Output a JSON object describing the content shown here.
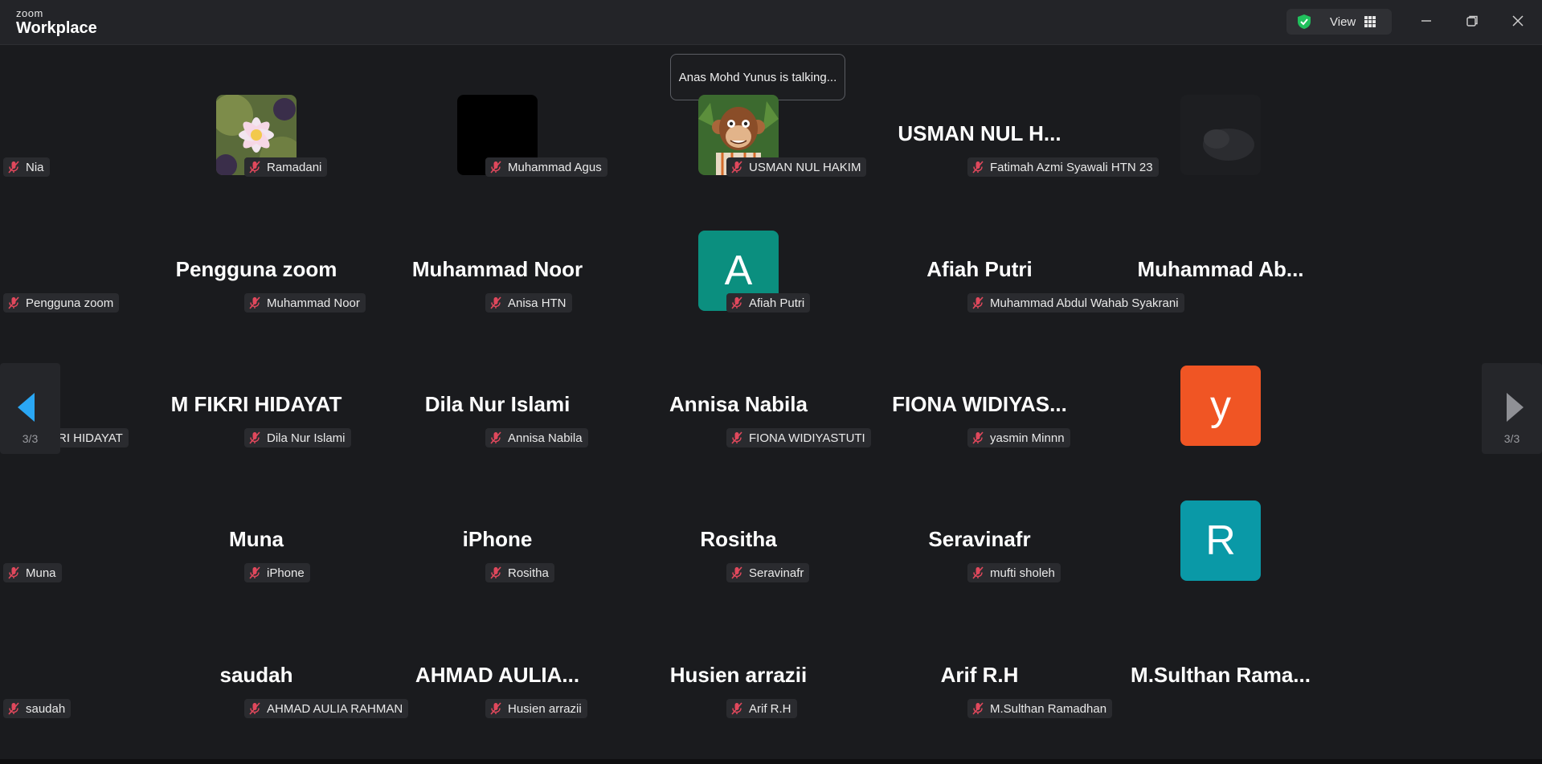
{
  "app": {
    "logo_top": "zoom",
    "logo_bottom": "Workplace"
  },
  "toolbar": {
    "view_label": "View",
    "security_icon": "shield-check-icon",
    "layout_icon": "grid-icon"
  },
  "window_controls": [
    "minimize-icon",
    "restore-icon",
    "close-icon"
  ],
  "toast": {
    "text": "Anas Mohd Yunus is talking..."
  },
  "pagination": {
    "left_label": "3/3",
    "right_label": "3/3"
  },
  "colors": {
    "background": "#1a1b1e",
    "shield_green": "#20c05c",
    "nav_arrow_blue": "#2aa7f4",
    "muted_mic_red": "#e0485c",
    "avatar_A": "#0b8f7f",
    "avatar_y": "#f05524",
    "avatar_R": "#0a99a7"
  },
  "participants": [
    {
      "name": "Nia",
      "display": "",
      "avatar": "lotus-image"
    },
    {
      "name": "Ramadani",
      "display": "",
      "avatar": "black-image"
    },
    {
      "name": "Muhammad Agus",
      "display": "",
      "avatar": "monkey-image"
    },
    {
      "name": "USMAN NUL HAKIM",
      "display": "USMAN NUL H...",
      "avatar": ""
    },
    {
      "name": "Fatimah Azmi Syawali HTN 23",
      "display": "",
      "avatar": "dark-photo-image"
    },
    {
      "name": "Pengguna zoom",
      "display": "Pengguna zoom",
      "avatar": ""
    },
    {
      "name": "Muhammad Noor",
      "display": "Muhammad Noor",
      "avatar": ""
    },
    {
      "name": "Anisa HTN",
      "display": "",
      "avatar": "letter",
      "letter": "A",
      "color": "#0b8f7f"
    },
    {
      "name": "Afiah Putri",
      "display": "Afiah Putri",
      "avatar": ""
    },
    {
      "name": "Muhammad Abdul Wahab Syakrani",
      "display": "Muhammad  Ab...",
      "avatar": ""
    },
    {
      "name": "M FIKRI HIDAYAT",
      "display": "M FIKRI HIDAYAT",
      "avatar": ""
    },
    {
      "name": "Dila Nur Islami",
      "display": "Dila Nur Islami",
      "avatar": ""
    },
    {
      "name": "Annisa Nabila",
      "display": "Annisa Nabila",
      "avatar": ""
    },
    {
      "name": "FIONA WIDIYASTUTI",
      "display": "FIONA  WIDIYAS...",
      "avatar": ""
    },
    {
      "name": "yasmin Minnn",
      "display": "",
      "avatar": "letter",
      "letter": "y",
      "color": "#f05524"
    },
    {
      "name": "Muna",
      "display": "Muna",
      "avatar": ""
    },
    {
      "name": "iPhone",
      "display": "iPhone",
      "avatar": ""
    },
    {
      "name": "Rositha",
      "display": "Rositha",
      "avatar": ""
    },
    {
      "name": "Seravinafr",
      "display": "Seravinafr",
      "avatar": ""
    },
    {
      "name": "mufti sholeh",
      "display": "",
      "avatar": "letter",
      "letter": "R",
      "color": "#0a99a7"
    },
    {
      "name": "saudah",
      "display": "saudah",
      "avatar": ""
    },
    {
      "name": "AHMAD AULIA RAHMAN",
      "display": "AHMAD  AULIA...",
      "avatar": ""
    },
    {
      "name": "Husien arrazii",
      "display": "Husien arrazii",
      "avatar": ""
    },
    {
      "name": "Arif R.H",
      "display": "Arif R.H",
      "avatar": ""
    },
    {
      "name": "M.Sulthan Ramadhan",
      "display": "M.Sulthan  Rama...",
      "avatar": ""
    }
  ]
}
